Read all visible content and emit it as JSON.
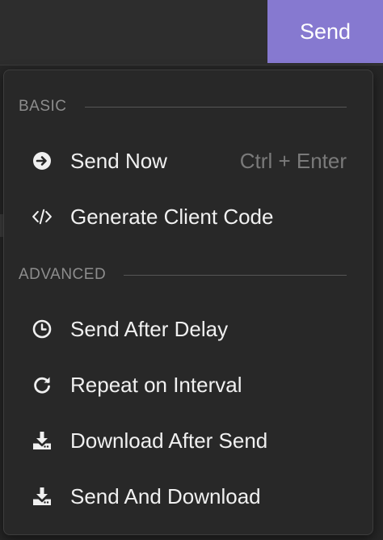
{
  "toolbar": {
    "send_label": "Send"
  },
  "menu": {
    "sections": [
      {
        "label": "BASIC",
        "items": [
          {
            "label": "Send Now",
            "shortcut": "Ctrl + Enter",
            "icon": "arrow-right-circle-icon"
          },
          {
            "label": "Generate Client Code",
            "icon": "code-icon"
          }
        ]
      },
      {
        "label": "ADVANCED",
        "items": [
          {
            "label": "Send After Delay",
            "icon": "clock-icon"
          },
          {
            "label": "Repeat on Interval",
            "icon": "repeat-icon"
          },
          {
            "label": "Download After Send",
            "icon": "download-icon"
          },
          {
            "label": "Send And Download",
            "icon": "download-icon"
          }
        ]
      }
    ]
  },
  "colors": {
    "accent": "#8679d0",
    "menu_bg": "#282828",
    "text": "#f0f0f0",
    "muted": "#8d8d8d"
  }
}
